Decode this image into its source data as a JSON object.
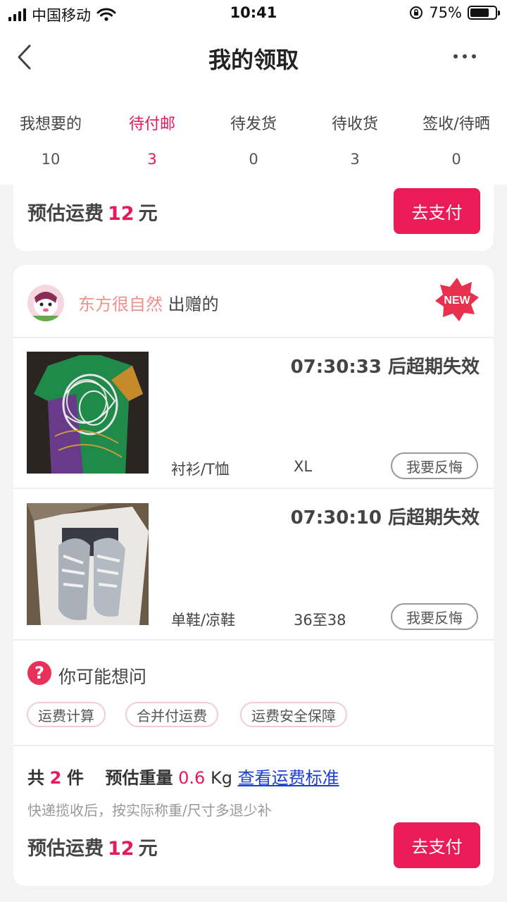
{
  "status": {
    "carrier": "中国移动",
    "time": "10:41",
    "battery": "75%",
    "battery_level": 0.75
  },
  "nav": {
    "title": "我的领取"
  },
  "tabs": [
    {
      "label": "我想要的",
      "count": "10"
    },
    {
      "label": "待付邮",
      "count": "3",
      "active": true
    },
    {
      "label": "待发货",
      "count": "0"
    },
    {
      "label": "待收货",
      "count": "3"
    },
    {
      "label": "签收/待晒",
      "count": "0"
    }
  ],
  "top_card": {
    "fee_label": "预估运费",
    "fee_value": "12",
    "fee_unit": "元",
    "pay_label": "去支付"
  },
  "order": {
    "giver_name": "东方很自然",
    "giver_suffix": "出赠的",
    "new_badge": "NEW",
    "items": [
      {
        "countdown": "07:30:33 后超期失效",
        "category": "衬衫/T恤",
        "size": "XL",
        "regret_label": "我要反悔"
      },
      {
        "countdown": "07:30:10 后超期失效",
        "category": "单鞋/凉鞋",
        "size": "36至38",
        "regret_label": "我要反悔"
      }
    ],
    "faq": {
      "icon": "?",
      "title": "你可能想问",
      "tags": [
        "运费计算",
        "合并付运费",
        "运费安全保障"
      ]
    },
    "summary": {
      "total_prefix": "共",
      "total_count": "2",
      "total_unit": "件",
      "weight_label": "预估重量",
      "weight_value": "0.6",
      "weight_unit": "Kg",
      "standard_link": "查看运费标准",
      "note": "快递揽收后，按实际称重/尺寸多退少补"
    },
    "fee_label": "预估运费",
    "fee_value": "12",
    "fee_unit": "元",
    "pay_label": "去支付"
  }
}
